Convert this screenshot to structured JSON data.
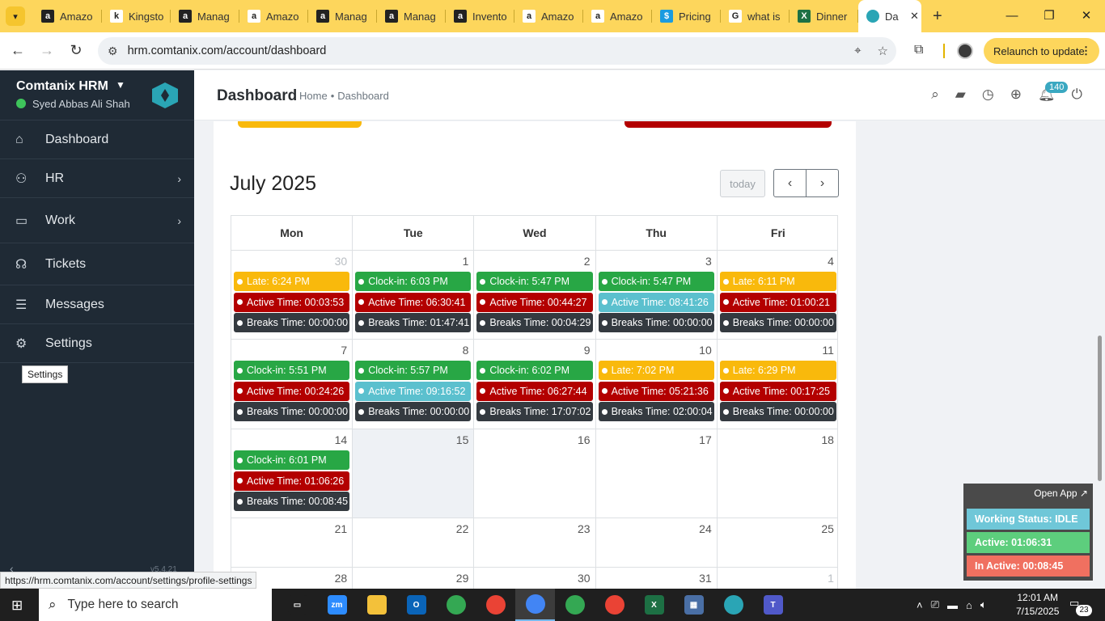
{
  "browser": {
    "tabs": [
      {
        "label": "Amazo",
        "icon": "amazon-icon",
        "color": "#222222",
        "glyph": "a"
      },
      {
        "label": "Kingsto",
        "icon": "amazon-icon",
        "color": "#ffffff",
        "glyph": "k"
      },
      {
        "label": "Manag",
        "icon": "amazon-icon",
        "color": "#222222",
        "glyph": "a"
      },
      {
        "label": "Amazo",
        "icon": "amazon-icon",
        "color": "#ffffff",
        "glyph": "a"
      },
      {
        "label": "Manag",
        "icon": "amazon-icon",
        "color": "#222222",
        "glyph": "a"
      },
      {
        "label": "Manag",
        "icon": "amazon-icon",
        "color": "#222222",
        "glyph": "a"
      },
      {
        "label": "Invento",
        "icon": "amazon-icon",
        "color": "#222222",
        "glyph": "a"
      },
      {
        "label": "Amazo",
        "icon": "amazon-icon",
        "color": "#ffffff",
        "glyph": "a"
      },
      {
        "label": "Amazo",
        "icon": "amazon-icon",
        "color": "#ffffff",
        "glyph": "a"
      },
      {
        "label": "Pricing",
        "icon": "dollar-icon",
        "color": "#1a9be0",
        "glyph": "$"
      },
      {
        "label": "what is",
        "icon": "google-icon",
        "color": "#ffffff",
        "glyph": "G"
      },
      {
        "label": "Dinner",
        "icon": "excel-icon",
        "color": "#1d7044",
        "glyph": "X"
      }
    ],
    "active_tab": {
      "label": "Da",
      "icon": "comtanix-icon"
    },
    "url": "hrm.comtanix.com/account/dashboard",
    "relaunch_label": "Relaunch to update",
    "status_link": "https://hrm.comtanix.com/account/settings/profile-settings"
  },
  "sidebar": {
    "brand": "Comtanix HRM",
    "user": "Syed Abbas Ali Shah",
    "items": [
      {
        "label": "Dashboard",
        "icon": "home-icon"
      },
      {
        "label": "HR",
        "icon": "users-icon"
      },
      {
        "label": "Work",
        "icon": "briefcase-icon"
      },
      {
        "label": "Tickets",
        "icon": "headset-icon"
      },
      {
        "label": "Messages",
        "icon": "message-icon"
      },
      {
        "label": "Settings",
        "icon": "gear-icon"
      }
    ],
    "tooltip": "Settings",
    "version": "v5.4.21"
  },
  "header": {
    "title": "Dashboard",
    "breadcrumb_home": "Home",
    "breadcrumb_current": "Dashboard",
    "notification_count": "140"
  },
  "calendar": {
    "title": "July 2025",
    "today_label": "today",
    "weekdays": [
      "Mon",
      "Tue",
      "Wed",
      "Thu",
      "Fri"
    ],
    "weeks": [
      [
        {
          "day": "30",
          "other": true,
          "events": [
            {
              "type": "yellow",
              "text": "Late: 6:24 PM"
            },
            {
              "type": "red",
              "text": "Active Time: 00:03:53"
            },
            {
              "type": "dark",
              "text": "Breaks Time: 00:00:00"
            }
          ]
        },
        {
          "day": "1",
          "events": [
            {
              "type": "green",
              "text": "Clock-in: 6:03 PM"
            },
            {
              "type": "red",
              "text": "Active Time: 06:30:41"
            },
            {
              "type": "dark",
              "text": "Breaks Time: 01:47:41"
            }
          ]
        },
        {
          "day": "2",
          "events": [
            {
              "type": "green",
              "text": "Clock-in: 5:47 PM"
            },
            {
              "type": "red",
              "text": "Active Time: 00:44:27"
            },
            {
              "type": "dark",
              "text": "Breaks Time: 00:04:29"
            }
          ]
        },
        {
          "day": "3",
          "events": [
            {
              "type": "green",
              "text": "Clock-in: 5:47 PM"
            },
            {
              "type": "teal",
              "text": "Active Time: 08:41:26"
            },
            {
              "type": "dark",
              "text": "Breaks Time: 00:00:00"
            }
          ]
        },
        {
          "day": "4",
          "events": [
            {
              "type": "yellow",
              "text": "Late: 6:11 PM"
            },
            {
              "type": "red",
              "text": "Active Time: 01:00:21"
            },
            {
              "type": "dark",
              "text": "Breaks Time: 00:00:00"
            }
          ]
        }
      ],
      [
        {
          "day": "7",
          "events": [
            {
              "type": "green",
              "text": "Clock-in: 5:51 PM"
            },
            {
              "type": "red",
              "text": "Active Time: 00:24:26"
            },
            {
              "type": "dark",
              "text": "Breaks Time: 00:00:00"
            }
          ]
        },
        {
          "day": "8",
          "events": [
            {
              "type": "green",
              "text": "Clock-in: 5:57 PM"
            },
            {
              "type": "teal",
              "text": "Active Time: 09:16:52"
            },
            {
              "type": "dark",
              "text": "Breaks Time: 00:00:00"
            }
          ]
        },
        {
          "day": "9",
          "events": [
            {
              "type": "green",
              "text": "Clock-in: 6:02 PM"
            },
            {
              "type": "red",
              "text": "Active Time: 06:27:44"
            },
            {
              "type": "dark",
              "text": "Breaks Time: 17:07:02"
            }
          ]
        },
        {
          "day": "10",
          "events": [
            {
              "type": "yellow",
              "text": "Late: 7:02 PM"
            },
            {
              "type": "red",
              "text": "Active Time: 05:21:36"
            },
            {
              "type": "dark",
              "text": "Breaks Time: 02:00:04"
            }
          ]
        },
        {
          "day": "11",
          "events": [
            {
              "type": "yellow",
              "text": "Late: 6:29 PM"
            },
            {
              "type": "red",
              "text": "Active Time: 00:17:25"
            },
            {
              "type": "dark",
              "text": "Breaks Time: 00:00:00"
            }
          ]
        }
      ],
      [
        {
          "day": "14",
          "events": [
            {
              "type": "green",
              "text": "Clock-in: 6:01 PM"
            },
            {
              "type": "red",
              "text": "Active Time: 01:06:26"
            },
            {
              "type": "dark",
              "text": "Breaks Time: 00:08:45"
            }
          ]
        },
        {
          "day": "15",
          "today": true,
          "events": []
        },
        {
          "day": "16",
          "events": []
        },
        {
          "day": "17",
          "events": []
        },
        {
          "day": "18",
          "events": []
        }
      ],
      [
        {
          "day": "21",
          "events": []
        },
        {
          "day": "22",
          "events": []
        },
        {
          "day": "23",
          "events": []
        },
        {
          "day": "24",
          "events": []
        },
        {
          "day": "25",
          "events": []
        }
      ],
      [
        {
          "day": "28",
          "events": []
        },
        {
          "day": "29",
          "events": []
        },
        {
          "day": "30",
          "events": []
        },
        {
          "day": "31",
          "events": []
        },
        {
          "day": "1",
          "other": true,
          "events": []
        }
      ]
    ]
  },
  "widget": {
    "open_app": "Open App ↗",
    "working_status": "Working Status: IDLE",
    "active": "Active: 01:06:31",
    "inactive": "In Active: 00:08:45"
  },
  "taskbar": {
    "search_placeholder": "Type here to search",
    "time": "12:01 AM",
    "date": "7/15/2025",
    "notification_count": "23",
    "apps": [
      {
        "name": "task-view-icon",
        "color": "#1f1f1f",
        "glyph": "▭"
      },
      {
        "name": "zoom-icon",
        "color": "#2d8cff",
        "glyph": "zm"
      },
      {
        "name": "file-explorer-icon",
        "color": "#f3c13a",
        "glyph": ""
      },
      {
        "name": "outlook-icon",
        "color": "#0a64b8",
        "glyph": "O"
      },
      {
        "name": "chrome-icon",
        "color": "#34a853",
        "glyph": ""
      },
      {
        "name": "chrome-icon",
        "color": "#ea4335",
        "glyph": ""
      },
      {
        "name": "chrome-icon",
        "color": "#4285f4",
        "glyph": "",
        "active": true
      },
      {
        "name": "chrome-icon",
        "color": "#34a853",
        "glyph": ""
      },
      {
        "name": "chrome-icon",
        "color": "#ea4335",
        "glyph": ""
      },
      {
        "name": "excel-icon",
        "color": "#1d7044",
        "glyph": "X"
      },
      {
        "name": "calculator-icon",
        "color": "#4a6fa5",
        "glyph": "▦"
      },
      {
        "name": "comtanix-icon",
        "color": "#2aa5b5",
        "glyph": ""
      },
      {
        "name": "teams-icon",
        "color": "#5059c9",
        "glyph": "T"
      }
    ]
  }
}
